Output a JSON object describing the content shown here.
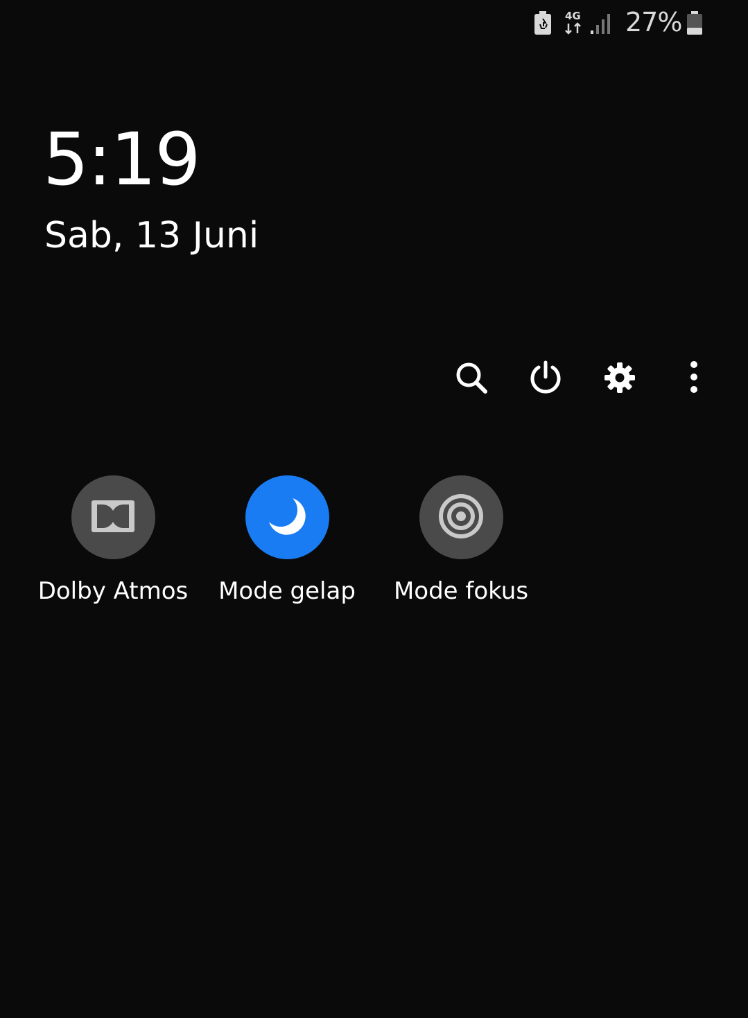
{
  "status_bar": {
    "network_type": "4G",
    "battery_percent": "27%",
    "icons": [
      "power-saving-icon",
      "network-4g-icon",
      "signal-strength-icon",
      "battery-icon"
    ]
  },
  "lockscreen": {
    "time": "5:19",
    "date": "Sab, 13 Juni"
  },
  "toolbar": {
    "icons": [
      "search-icon",
      "power-icon",
      "gear-icon",
      "more-vertical-icon"
    ]
  },
  "tiles": [
    {
      "label": "Dolby Atmos",
      "icon": "dolby-icon",
      "active": false
    },
    {
      "label": "Mode gelap",
      "icon": "moon-icon",
      "active": true
    },
    {
      "label": "Mode fokus",
      "icon": "target-icon",
      "active": false
    }
  ],
  "colors": {
    "background": "#0a0a0a",
    "tile_inactive": "#4a4a4a",
    "tile_active": "#1a7cf2",
    "text": "#ffffff"
  }
}
